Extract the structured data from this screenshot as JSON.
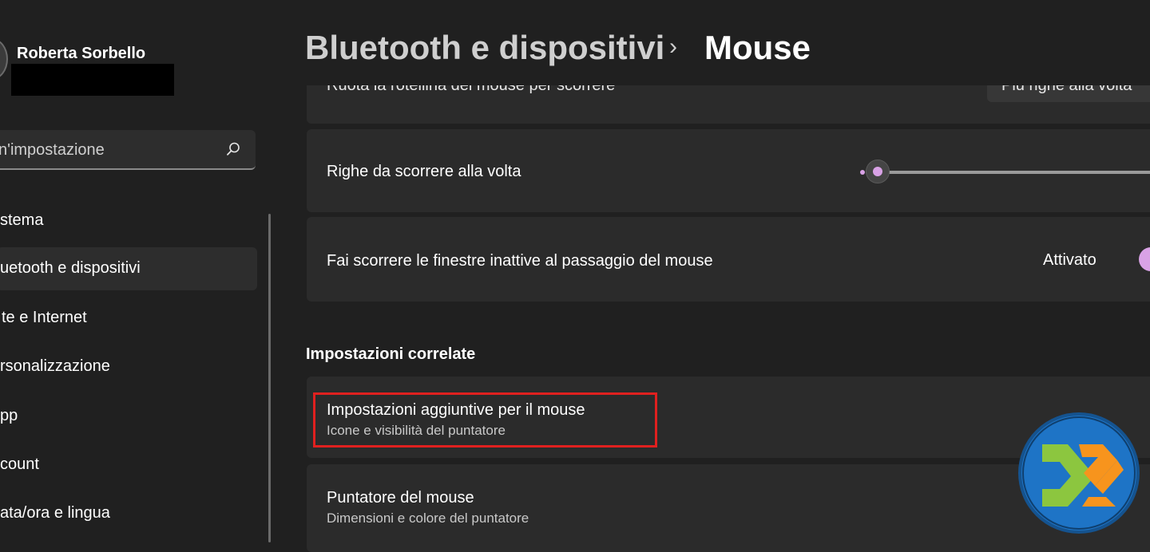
{
  "user": {
    "name": "Roberta Sorbello"
  },
  "search": {
    "placeholder": "n'impostazione"
  },
  "sidebar": {
    "items": [
      {
        "label": "stema"
      },
      {
        "label": "uetooth e dispositivi"
      },
      {
        "label": "te e Internet"
      },
      {
        "label": "rsonalizzazione"
      },
      {
        "label": "pp"
      },
      {
        "label": "count"
      },
      {
        "label": "ata/ora e lingua"
      }
    ],
    "selected_index": 1
  },
  "breadcrumb": {
    "parent": "Bluetooth e dispositivi",
    "separator": "›",
    "current": "Mouse"
  },
  "settings": {
    "wheel": {
      "title": "Ruota la rotellina del mouse per scorrere",
      "value": "Più righe alla volta"
    },
    "lines": {
      "title": "Righe da scorrere alla volta",
      "slider_value_fraction": 0.04
    },
    "inactive": {
      "title": "Fai scorrere le finestre inattive al passaggio del mouse",
      "state_label": "Attivato",
      "on": true
    }
  },
  "related": {
    "heading": "Impostazioni correlate",
    "items": [
      {
        "title": "Impostazioni aggiuntive per il mouse",
        "subtitle": "Icone e visibilità del puntatore",
        "highlighted": true
      },
      {
        "title": "Puntatore del mouse",
        "subtitle": "Dimensioni e colore del puntatore"
      }
    ]
  },
  "colors": {
    "accent": "#d9a2e6",
    "highlight": "#e0201f",
    "logo_blue": "#1e74c6",
    "logo_green": "#8cc63f",
    "logo_orange": "#f7941d"
  },
  "watermark": {
    "icon": "logo-icon"
  }
}
